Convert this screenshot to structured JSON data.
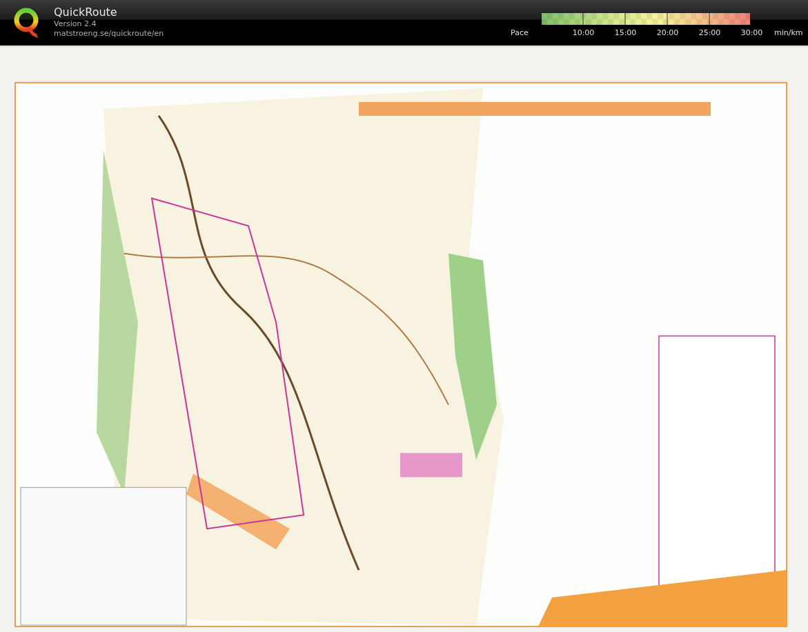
{
  "app": {
    "title": "QuickRoute",
    "version": "Version 2.4",
    "url": "matstroeng.se/quickroute/en"
  },
  "pace_legend": {
    "label": "Pace",
    "ticks": [
      "10:00",
      "15:00",
      "20:00",
      "25:00",
      "30:00"
    ],
    "unit": "min/km"
  }
}
